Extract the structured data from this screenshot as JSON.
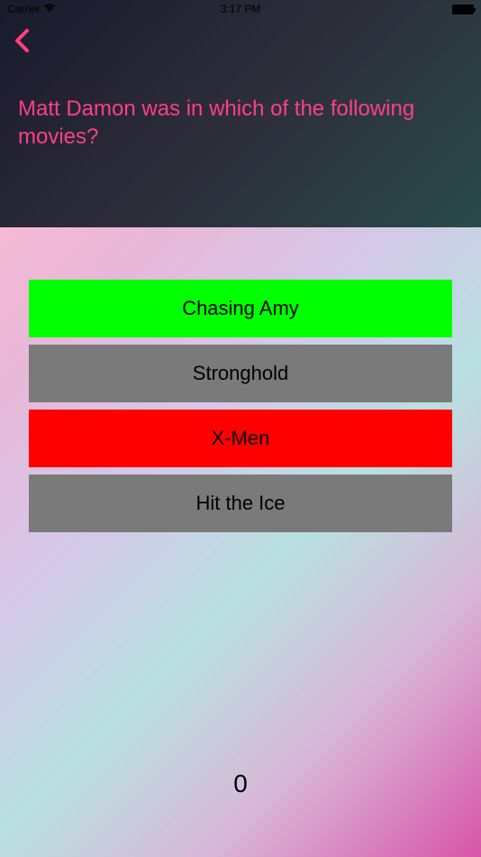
{
  "statusBar": {
    "carrier": "Carrier",
    "time": "3:17 PM"
  },
  "question": "Matt Damon was in which of the following movies?",
  "answers": [
    {
      "label": "Chasing Amy",
      "state": "correct"
    },
    {
      "label": "Stronghold",
      "state": "default"
    },
    {
      "label": "X-Men",
      "state": "wrong"
    },
    {
      "label": "Hit the Ice",
      "state": "default"
    }
  ],
  "score": "0"
}
